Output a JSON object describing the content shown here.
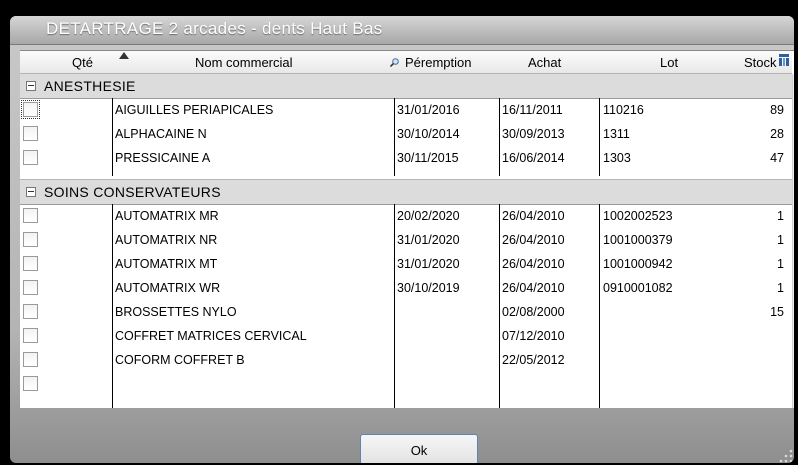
{
  "dialog": {
    "title": "DETARTRAGE 2 arcades - dents Haut Bas",
    "ok_label": "Ok"
  },
  "columns": {
    "qty": "Qté",
    "name": "Nom commercial",
    "expiry": "Péremption",
    "purchase": "Achat",
    "lot": "Lot",
    "stock": "Stock"
  },
  "groups": [
    {
      "label": "ANESTHESIE",
      "rows": [
        {
          "name": "AIGUILLES PERIAPICALES",
          "expiry": "31/01/2016",
          "purchase": "16/11/2011",
          "lot": "110216",
          "stock": "89"
        },
        {
          "name": "ALPHACAINE N",
          "expiry": "30/10/2014",
          "purchase": "30/09/2013",
          "lot": "1311",
          "stock": "28"
        },
        {
          "name": "PRESSICAINE A",
          "expiry": "30/11/2015",
          "purchase": "16/06/2014",
          "lot": "1303",
          "stock": "47"
        }
      ]
    },
    {
      "label": "SOINS CONSERVATEURS",
      "rows": [
        {
          "name": "AUTOMATRIX  MR",
          "expiry": "20/02/2020",
          "purchase": "26/04/2010",
          "lot": "1002002523",
          "stock": "1"
        },
        {
          "name": "AUTOMATRIX  NR",
          "expiry": "31/01/2020",
          "purchase": "26/04/2010",
          "lot": "1001000379",
          "stock": "1"
        },
        {
          "name": "AUTOMATRIX MT",
          "expiry": "31/01/2020",
          "purchase": "26/04/2010",
          "lot": "1001000942",
          "stock": "1"
        },
        {
          "name": "AUTOMATRIX WR",
          "expiry": "30/10/2019",
          "purchase": "26/04/2010",
          "lot": "0910001082",
          "stock": "1"
        },
        {
          "name": "BROSSETTES NYLO",
          "expiry": "",
          "purchase": "02/08/2000",
          "lot": "",
          "stock": "15"
        },
        {
          "name": "COFFRET MATRICES CERVICAL",
          "expiry": "",
          "purchase": "07/12/2010",
          "lot": "",
          "stock": ""
        },
        {
          "name": "COFORM COFFRET B",
          "expiry": "",
          "purchase": "22/05/2012",
          "lot": "",
          "stock": ""
        }
      ]
    }
  ],
  "icons": {
    "sort": "sort-ascending-icon",
    "search": "magnifier-icon",
    "settings": "column-settings-icon",
    "group_toggle": "collapse-minus-icon",
    "scroll_up": "arrow-up-icon",
    "scroll_down": "arrow-down-icon"
  },
  "colors": {
    "title_text": "#ffffff",
    "group_band": "#dcdcdc",
    "ok_border": "#5a86b5"
  }
}
